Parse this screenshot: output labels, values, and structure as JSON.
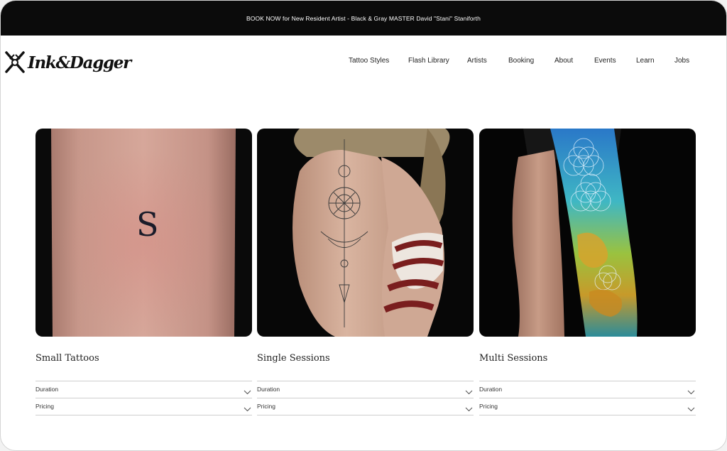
{
  "announcement": "BOOK NOW for New Resident Artist - Black & Gray MASTER David \"Stani\" Staniforth",
  "brand": {
    "name": "Ink&Dagger"
  },
  "nav": [
    "Tattoo Styles",
    "Flash Library",
    "Artists",
    "Booking",
    "About",
    "Events",
    "Learn",
    "Jobs"
  ],
  "cards": [
    {
      "title": "Small Tattoos",
      "image_letter": "S",
      "accordions": [
        "Duration",
        "Pricing"
      ]
    },
    {
      "title": "Single Sessions",
      "accordions": [
        "Duration",
        "Pricing"
      ]
    },
    {
      "title": "Multi Sessions",
      "accordions": [
        "Duration",
        "Pricing"
      ]
    }
  ],
  "icons": {
    "logo": "dagger-logo-icon",
    "chevron": "chevron-down-icon"
  },
  "colors": {
    "announcement_bg": "#0b0b0b",
    "page_bg": "#ffffff",
    "text": "#222222"
  }
}
